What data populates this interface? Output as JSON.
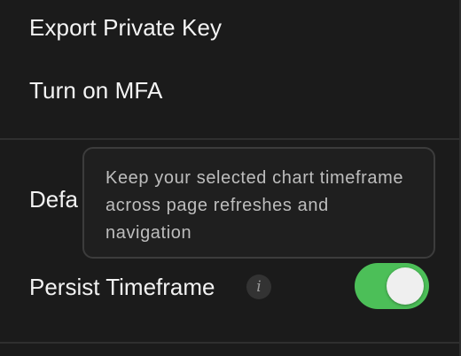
{
  "menu": {
    "export_private_key": "Export Private Key",
    "turn_on_mfa": "Turn on MFA"
  },
  "settings": {
    "default_row_label": "Defa",
    "persist_timeframe_label": "Persist Timeframe",
    "persist_timeframe_enabled": true,
    "info_icon_glyph": "i"
  },
  "tooltip": {
    "text": "Keep your selected chart timeframe across page refreshes and navigation"
  },
  "colors": {
    "background": "#1b1b1b",
    "toggle_on": "#4cbf58",
    "divider": "#2f2f2f"
  }
}
